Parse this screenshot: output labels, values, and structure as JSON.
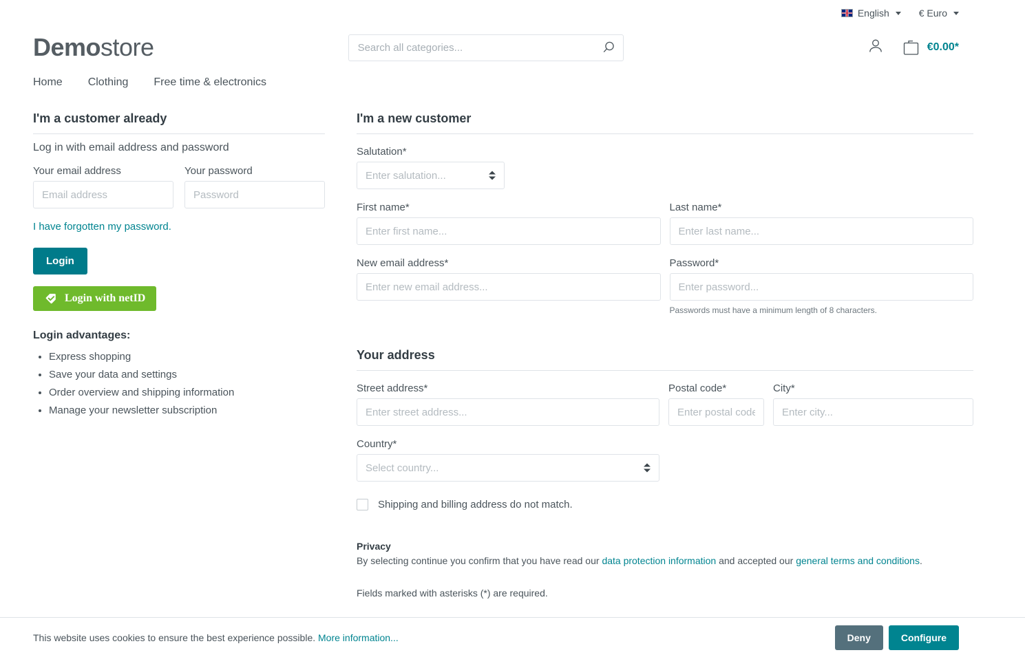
{
  "topbar": {
    "flag_icon": "uk-flag-icon",
    "language": "English",
    "currency": "€ Euro"
  },
  "header": {
    "logo_bold": "Demo",
    "logo_light": "store",
    "search_placeholder": "Search all categories...",
    "search_value": "",
    "search_icon": "search-icon",
    "account_icon": "user-icon",
    "cart_icon": "shopping-bag-icon",
    "cart_amount": "€0.00*"
  },
  "nav": {
    "items": [
      {
        "label": "Home"
      },
      {
        "label": "Clothing"
      },
      {
        "label": "Free time & electronics"
      }
    ]
  },
  "login": {
    "title": "I'm a customer already",
    "subtitle": "Log in with email address and password",
    "email_label": "Your email address",
    "email_placeholder": "Email address",
    "email_value": "",
    "password_label": "Your password",
    "password_placeholder": "Password",
    "password_value": "",
    "forgot_link": "I have forgotten my password.",
    "login_button": "Login",
    "netid_button": "Login with netID",
    "netid_icon": "netid-check-tag-icon",
    "advantages_title": "Login advantages:",
    "advantages": [
      "Express shopping",
      "Save your data and settings",
      "Order overview and shipping information",
      "Manage your newsletter subscription"
    ]
  },
  "register": {
    "title": "I'm a new customer",
    "salutation_label": "Salutation*",
    "salutation_placeholder": "Enter salutation...",
    "first_name_label": "First name*",
    "first_name_placeholder": "Enter first name...",
    "first_name_value": "",
    "last_name_label": "Last name*",
    "last_name_placeholder": "Enter last name...",
    "last_name_value": "",
    "email_label": "New email address*",
    "email_placeholder": "Enter new email address...",
    "email_value": "",
    "password_label": "Password*",
    "password_placeholder": "Enter password...",
    "password_value": "",
    "password_help": "Passwords must have a minimum length of 8 characters."
  },
  "address": {
    "title": "Your address",
    "street_label": "Street address*",
    "street_placeholder": "Enter street address...",
    "street_value": "",
    "postal_label": "Postal code*",
    "postal_placeholder": "Enter postal code...",
    "postal_value": "",
    "city_label": "City*",
    "city_placeholder": "Enter city...",
    "city_value": "",
    "country_label": "Country*",
    "country_placeholder": "Select country...",
    "different_shipping_label": "Shipping and billing address do not match.",
    "different_shipping_checked": false
  },
  "privacy": {
    "title": "Privacy",
    "text_before": "By selecting continue you confirm that you have read our ",
    "data_protection_link": "data protection information",
    "text_middle": " and accepted our ",
    "terms_link": "general terms and conditions",
    "text_after": ".",
    "required_note": "Fields marked with asterisks (*) are required."
  },
  "cookie_bar": {
    "text": "This website uses cookies to ensure the best experience possible. ",
    "more_link": "More information...",
    "deny_button": "Deny",
    "configure_button": "Configure"
  },
  "colors": {
    "accent_teal": "#008490",
    "login_teal": "#007b8a",
    "netid_green": "#6fba2c",
    "deny_grey": "#54707c",
    "text": "#4a545b"
  }
}
